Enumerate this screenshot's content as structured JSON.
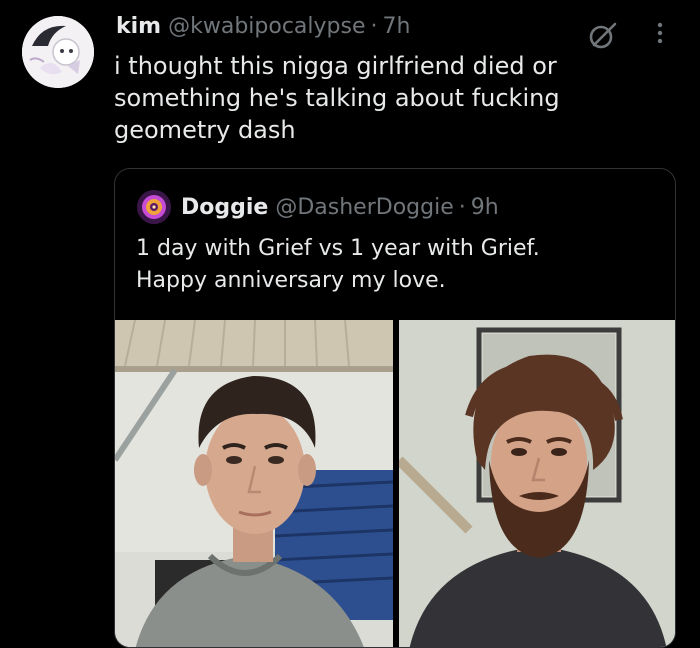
{
  "tweet": {
    "display_name": "kim",
    "handle": "@kwabipocalypse",
    "separator": "·",
    "time": "7h",
    "text": "i thought this nigga girlfriend died or something he's talking about fucking geometry dash"
  },
  "quote": {
    "display_name": "Doggie",
    "handle": "@DasherDoggie",
    "separator": "·",
    "time": "9h",
    "text_line1": "1 day with Grief vs 1 year with Grief.",
    "text_line2": "Happy anniversary my love."
  },
  "icons": {
    "grok": "grok-icon",
    "more": "more-icon"
  },
  "colors": {
    "background": "#000000",
    "text_primary": "#e7e9ea",
    "text_secondary": "#71767b",
    "border": "#2f3336"
  }
}
